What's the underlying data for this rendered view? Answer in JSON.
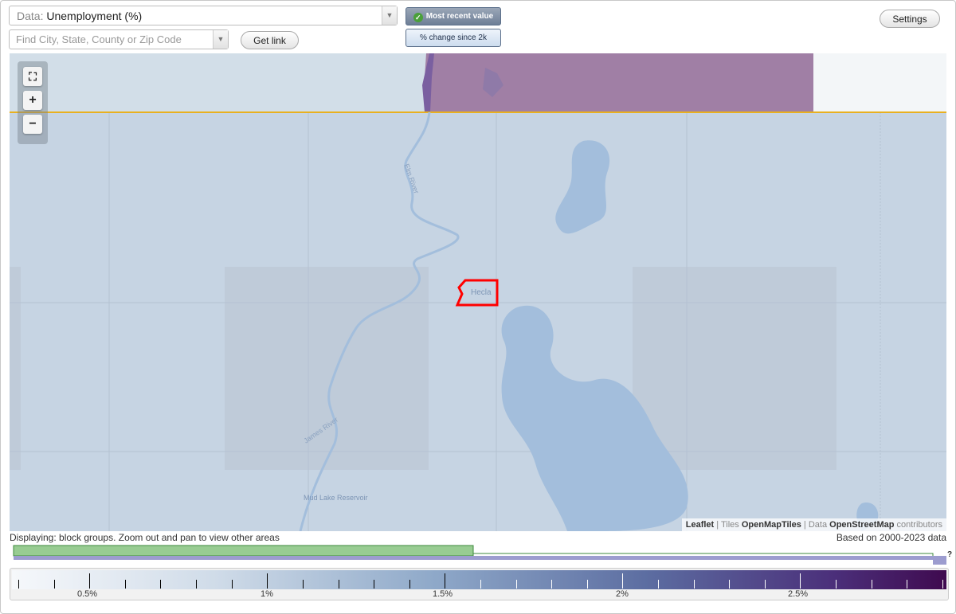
{
  "toolbar": {
    "data_prefix": "Data:",
    "data_value": "Unemployment (%)",
    "search_placeholder": "Find City, State, County or Zip Code",
    "get_link_label": "Get link",
    "toggle_recent": "Most recent value",
    "toggle_change": "% change since 2k",
    "settings_label": "Settings"
  },
  "map": {
    "place_label": "Hecla",
    "river_label": "Elm River",
    "river_label_2": "James River",
    "reservoir_label": "Mud Lake Reservoir",
    "zoom_fit_icon": "fullscreen-icon",
    "zoom_in": "+",
    "zoom_out": "−",
    "attribution": {
      "leaflet": "Leaflet",
      "tiles_prefix": "Tiles",
      "tiles": "OpenMapTiles",
      "data_prefix": "Data",
      "data": "OpenStreetMap",
      "data_suffix": "contributors"
    },
    "colors": {
      "state_line": "#e8b020",
      "highlight": "#ff0000",
      "purple_area": "#a07fa5",
      "water": "#a3bedc"
    }
  },
  "status": {
    "displaying": "Displaying: block groups. Zoom out and pan to view other areas",
    "based_on": "Based on 2000-2023 data",
    "timeline_mark": "?"
  },
  "legend": {
    "labels": [
      "0.5%",
      "1%",
      "1.5%",
      "2%",
      "2.5%"
    ],
    "colors": [
      "#f6f8fb",
      "#8fa9c9",
      "#5c6da1",
      "#3f0a4f"
    ]
  }
}
